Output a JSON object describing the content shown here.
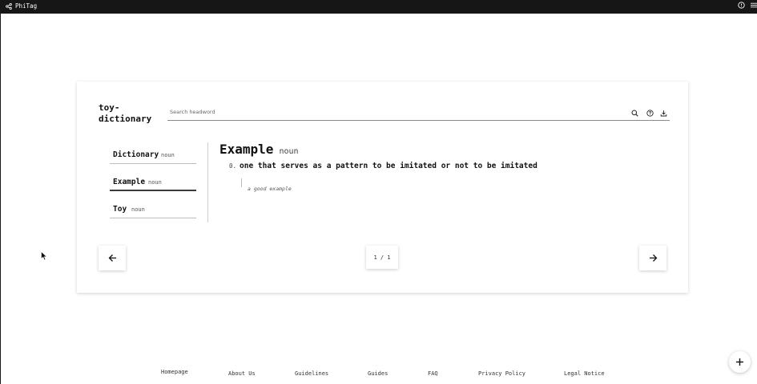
{
  "topbar": {
    "brand": "PhiTag",
    "icons": [
      "share-icon",
      "help-circle-icon",
      "menu-icon"
    ]
  },
  "dictionary": {
    "title": "toy-\ndictionary",
    "search_placeholder": "Search headword",
    "search_value": "",
    "toolbar_icons": [
      "search-icon",
      "help-icon",
      "download-icon"
    ]
  },
  "list": {
    "items": [
      {
        "word": "Dictionary",
        "pos": "noun",
        "active": false
      },
      {
        "word": "Example",
        "pos": "noun",
        "active": true
      },
      {
        "word": "Toy",
        "pos": "noun",
        "active": false
      }
    ]
  },
  "entry": {
    "word": "Example",
    "pos": "noun",
    "senses": [
      {
        "number": "0.",
        "definition": "one that serves as a pattern to be imitated or not to be imitated",
        "example": "a good example"
      }
    ]
  },
  "pager": {
    "indicator": "1 / 1",
    "prev_icon": "arrow-left-icon",
    "next_icon": "arrow-right-icon"
  },
  "footer": {
    "links": [
      "Homepage",
      "About Us",
      "Guidelines",
      "Guides",
      "FAQ",
      "Privacy Policy",
      "Legal Notice"
    ]
  },
  "fab": {
    "icon": "plus-icon"
  },
  "colors": {
    "topbar": "#161616",
    "text": "#1a1a1a",
    "muted": "#555555"
  }
}
